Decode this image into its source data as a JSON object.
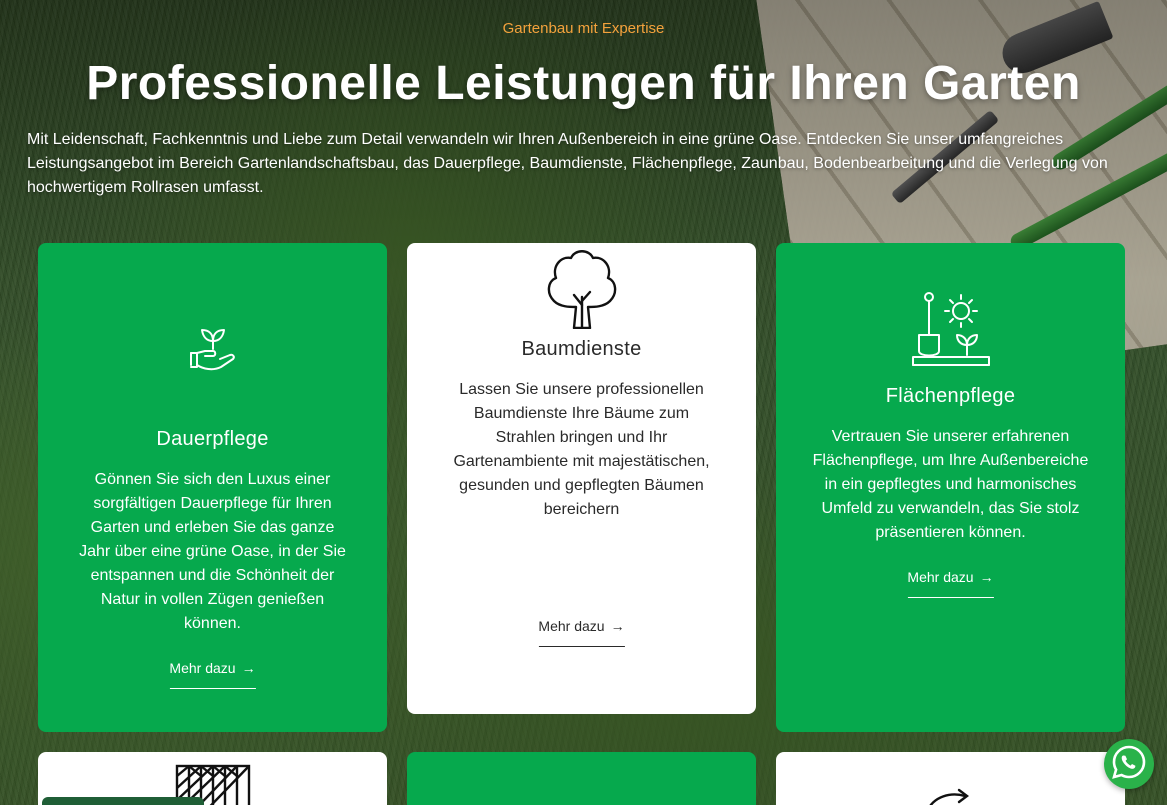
{
  "hero": {
    "eyebrow": "Gartenbau mit Expertise",
    "headline": "Professionelle Leistungen für Ihren Garten",
    "intro": "Mit Leidenschaft, Fachkenntnis und Liebe zum Detail verwandeln wir Ihren Außenbereich in eine grüne Oase. Entdecken Sie unser umfangreiches Leistungsangebot im Bereich Gartenlandschaftsbau, das Dauerpflege, Baumdienste, Flächenpflege, Zaunbau, Bodenbearbeitung und die Verlegung von hochwertigem Rollrasen umfasst."
  },
  "colors": {
    "accent_green": "#06a94d",
    "eyebrow_orange": "#f4a23c",
    "whatsapp_green": "#2ab24a"
  },
  "services": [
    {
      "icon": "hand-plant-icon",
      "title": "Dauerpflege",
      "text": "Gönnen Sie sich den Luxus einer sorgfältigen Dauerpflege für Ihren Garten und erleben Sie das ganze Jahr über eine grüne Oase, in der Sie entspannen und die Schönheit der Natur in vollen Zügen genießen können.",
      "link": "Mehr dazu",
      "arrow": "→"
    },
    {
      "icon": "tree-icon",
      "title": "Baumdienste",
      "text": "Lassen Sie unsere professionellen Baumdienste Ihre Bäume zum Strahlen bringen und Ihr Gartenambiente mit majestätischen, gesunden und gepflegten Bäumen bereichern",
      "link": "Mehr dazu",
      "arrow": "→"
    },
    {
      "icon": "shovel-sun-sprout-icon",
      "title": "Flächenpflege",
      "text": "Vertrauen Sie unserer erfahrenen Flächenpflege, um Ihre Außenbereiche in ein gepflegtes und harmonisches Umfeld zu verwandeln, das Sie stolz präsentieren können.",
      "link": "Mehr dazu",
      "arrow": "→"
    }
  ],
  "next_row_icons": [
    "fence-icon",
    "",
    "hand-arrow-icon"
  ],
  "whatsapp": {
    "icon": "whatsapp-icon"
  }
}
